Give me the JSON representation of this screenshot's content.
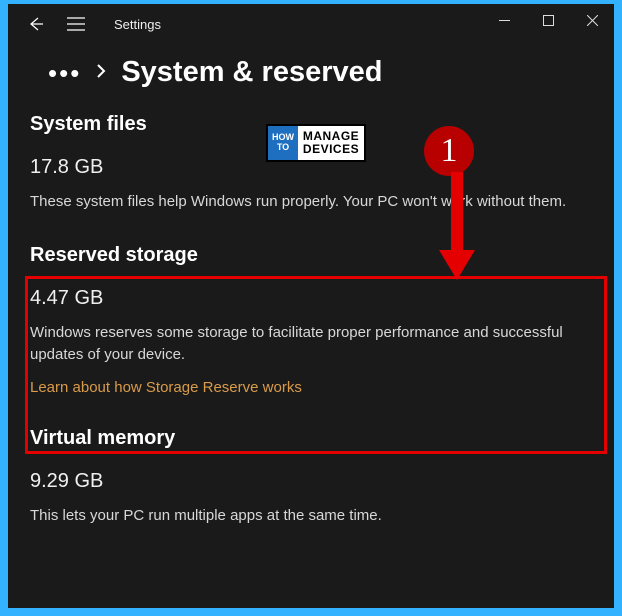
{
  "titlebar": {
    "app_name": "Settings"
  },
  "breadcrumb": {
    "page_title": "System & reserved"
  },
  "sections": {
    "system_files": {
      "title": "System files",
      "value": "17.8 GB",
      "description": "These system files help Windows run properly. Your PC won't work without them."
    },
    "reserved_storage": {
      "title": "Reserved storage",
      "value": "4.47 GB",
      "description": "Windows reserves some storage to facilitate proper performance and successful updates of your device.",
      "link_label": "Learn about how Storage Reserve works"
    },
    "virtual_memory": {
      "title": "Virtual memory",
      "value": "9.29 GB",
      "description": "This lets your PC run multiple apps at the same time."
    }
  },
  "annotation": {
    "marker_number": "1"
  },
  "watermark": {
    "left_top": "HOW",
    "left_bottom": "TO",
    "right_top": "MANAGE",
    "right_bottom": "DEVICES"
  }
}
